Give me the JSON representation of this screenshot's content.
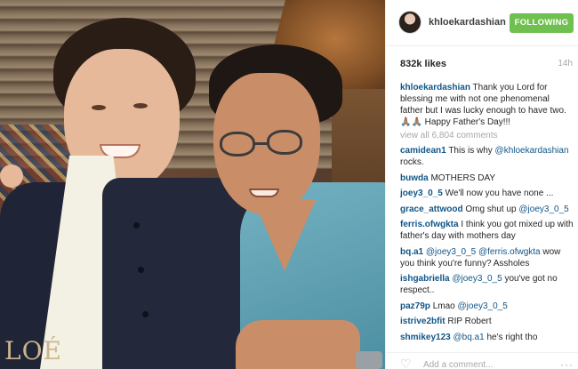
{
  "photo": {
    "alt_subject": "two-men-photo",
    "shirt_text": "LOÉ"
  },
  "post": {
    "username": "khloekardashian",
    "follow_label": "FOLLOWING",
    "likes": "832k likes",
    "time": "14h",
    "caption": "Thank you Lord for blessing me with not one phenomenal father but I was lucky enough to have two. 🙏🏽🙏🏽 Happy Father's Day!!!",
    "view_all": "view all 6,804 comments",
    "add_comment_placeholder": "Add a comment...",
    "more_label": "···"
  },
  "comments": [
    {
      "user": "camidean1",
      "text": "This is why",
      "mention": "@khloekardashian",
      "after": " rocks."
    },
    {
      "user": "buwda",
      "text": "MOTHERS DAY",
      "mention": "",
      "after": ""
    },
    {
      "user": "joey3_0_5",
      "text": "We'll now you have none ...",
      "mention": "",
      "after": ""
    },
    {
      "user": "grace_attwood",
      "text": "Omg shut up",
      "mention": "@joey3_0_5",
      "after": ""
    },
    {
      "user": "ferris.ofwgkta",
      "text": "I think you got mixed up with father's day with mothers day",
      "mention": "",
      "after": ""
    },
    {
      "user": "bq.a1",
      "text": "",
      "mention": "@joey3_0_5 @ferris.ofwgkta",
      "after": " wow you think you're funny? Assholes"
    },
    {
      "user": "ishgabriella",
      "text": "",
      "mention": "@joey3_0_5",
      "after": " you've got no respect.."
    },
    {
      "user": "paz79p",
      "text": "Lmao",
      "mention": "@joey3_0_5",
      "after": ""
    },
    {
      "user": "istrive2bfit",
      "text": "RIP Robert",
      "mention": "",
      "after": ""
    },
    {
      "user": "shmikey123",
      "text": "",
      "mention": "@bq.a1",
      "after": " he's right tho"
    }
  ],
  "colors": {
    "follow_green": "#70c050",
    "username_blue": "#125688",
    "muted_gray": "#a5a7aa"
  },
  "icons": {
    "like": "heart-outline-icon",
    "more": "more-options-icon"
  }
}
